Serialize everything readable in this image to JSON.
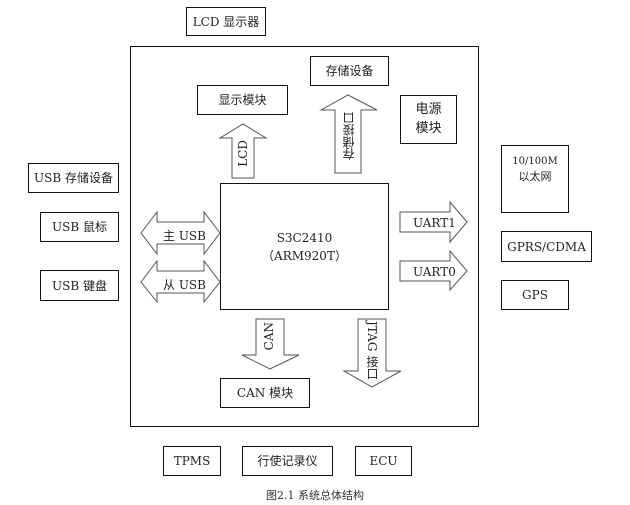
{
  "diagram": {
    "caption": "图2.1  系统总体结构",
    "cpu": {
      "line1": "S3C2410",
      "line2": "（ARM920T）"
    },
    "external": {
      "lcd_display": "LCD 显示器",
      "usb_storage": "USB 存储设备",
      "usb_mouse": "USB 鼠标",
      "usb_keyboard": "USB 键盘",
      "ethernet_line1": "10/100M",
      "ethernet_line2": "以太网",
      "gprs_cdma": "GPRS/CDMA",
      "gps": "GPS",
      "tpms": "TPMS",
      "recorder": "行使记录仪",
      "ecu": "ECU"
    },
    "internal": {
      "display_module": "显示模块",
      "storage_device": "存储设备",
      "power_line1": "电源",
      "power_line2": "模块",
      "can_module": "CAN 模块"
    },
    "arrows": {
      "lcd": "LCD",
      "storage_interface": "存储接口",
      "usb_host": "主 USB",
      "usb_slave": "从 USB",
      "uart1": "UART1",
      "uart0": "UART0",
      "can": "CAN",
      "jtag": "JTAG 接口"
    }
  }
}
